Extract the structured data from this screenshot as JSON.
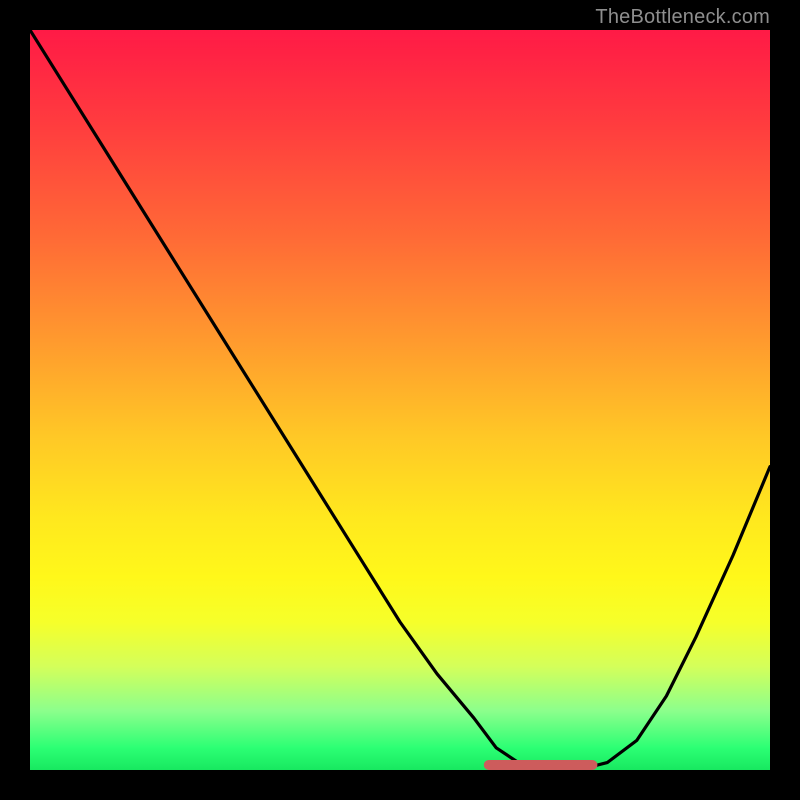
{
  "attribution": "TheBottleneck.com",
  "colors": {
    "page_bg": "#000000",
    "grad_top": "#ff1a46",
    "grad_mid": "#ffe81e",
    "grad_bottom": "#18e860",
    "curve": "#000000",
    "flat_segment": "#cd5c5c",
    "attribution_text": "#8e8e8e"
  },
  "chart_data": {
    "type": "line",
    "title": "",
    "xlabel": "",
    "ylabel": "",
    "xlim": [
      0,
      100
    ],
    "ylim": [
      0,
      100
    ],
    "x": [
      0,
      5,
      10,
      15,
      20,
      25,
      30,
      35,
      40,
      45,
      50,
      55,
      60,
      63,
      66,
      70,
      74,
      78,
      82,
      86,
      90,
      95,
      100
    ],
    "values": [
      100,
      92,
      84,
      76,
      68,
      60,
      52,
      44,
      36,
      28,
      20,
      13,
      7,
      3,
      1,
      0,
      0,
      1,
      4,
      10,
      18,
      29,
      41
    ],
    "flat_segment": {
      "x_start": 62,
      "x_end": 76,
      "y": 0
    },
    "note": "Values estimated from pixel positions; y=0 is the bottom (green), y=100 is the top (red)."
  }
}
